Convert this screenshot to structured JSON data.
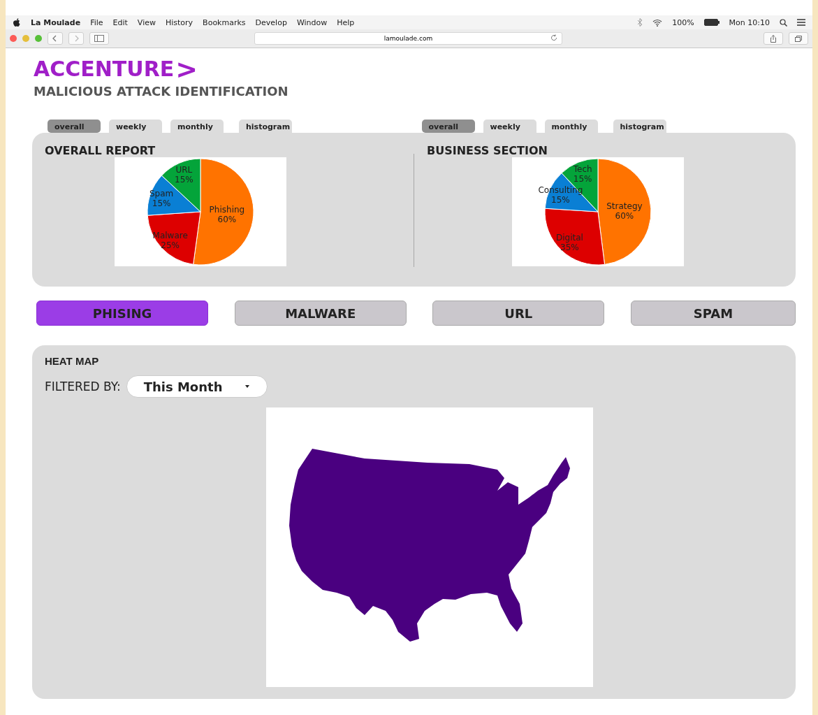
{
  "menu_bar": {
    "app": "La Moulade",
    "items": [
      "File",
      "Edit",
      "View",
      "History",
      "Bookmarks",
      "Develop",
      "Window",
      "Help"
    ],
    "battery": "100%",
    "clock": "Mon 10:10"
  },
  "toolbar": {
    "address": "lamoulade.com"
  },
  "header": {
    "logo": "ACCENTURE",
    "logo_mark": ">",
    "subtitle": "MALICIOUS ATTACK IDENTIFICATION"
  },
  "panels": [
    {
      "tabs": [
        {
          "label": "overall",
          "selected": true
        },
        {
          "label": "weekly",
          "selected": false
        },
        {
          "label": "monthly",
          "selected": false
        },
        {
          "label": "histogram",
          "selected": false
        }
      ],
      "title": "OVERALL REPORT",
      "chart_data": {
        "type": "pie",
        "categories": [
          "Phishing",
          "Malware",
          "Spam",
          "URL"
        ],
        "values": [
          60,
          25,
          15,
          15
        ],
        "value_labels": [
          "60%",
          "25%",
          "15%",
          "15%"
        ]
      }
    },
    {
      "tabs": [
        {
          "label": "overall",
          "selected": true
        },
        {
          "label": "weekly",
          "selected": false
        },
        {
          "label": "monthly",
          "selected": false
        },
        {
          "label": "histogram",
          "selected": false
        }
      ],
      "title": "BUSINESS SECTION",
      "chart_data": {
        "type": "pie",
        "categories": [
          "Strategy",
          "Digital",
          "Consulting",
          "Tech"
        ],
        "values": [
          60,
          35,
          15,
          15
        ],
        "value_labels": [
          "60%",
          "35%",
          "15%",
          "15%"
        ]
      }
    }
  ],
  "categories": [
    {
      "label": "PHISING",
      "selected": true
    },
    {
      "label": "MALWARE",
      "selected": false
    },
    {
      "label": "URL",
      "selected": false
    },
    {
      "label": "SPAM",
      "selected": false
    }
  ],
  "heat_map": {
    "title": "HEAT MAP",
    "filter_label": "FILTERED BY:",
    "filter_value": "This Month"
  }
}
